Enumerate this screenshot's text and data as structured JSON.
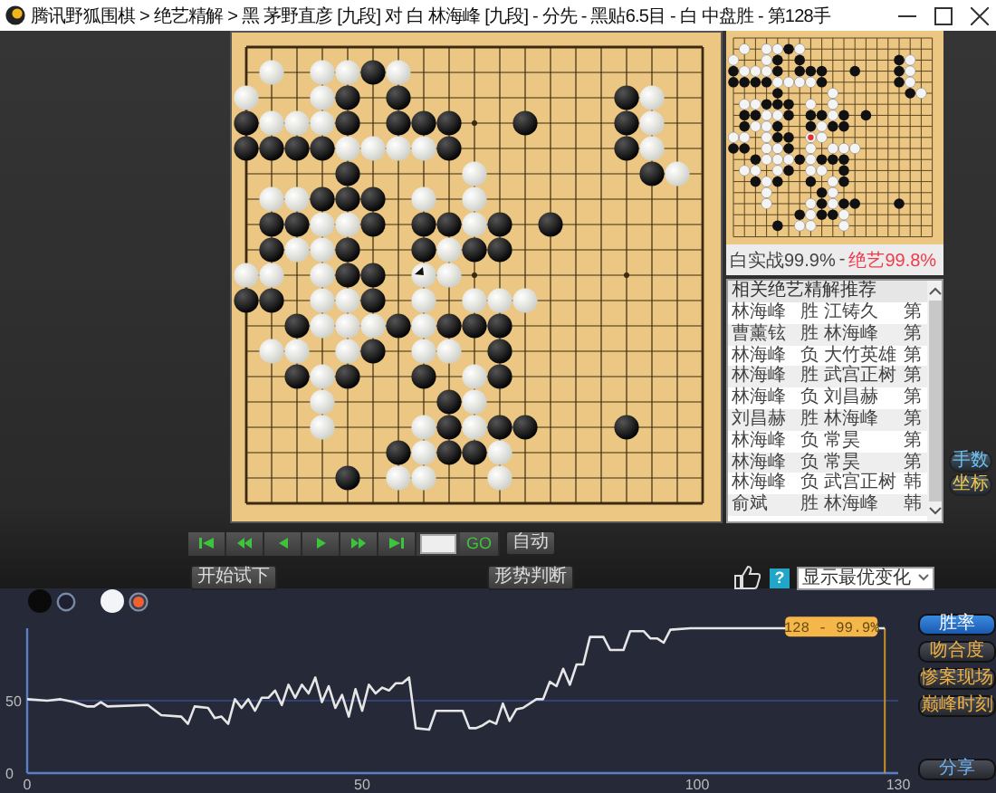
{
  "window": {
    "title": "腾讯野狐围棋 > 绝艺精解 > 黑 茅野直彦 [九段] 对 白 林海峰 [九段] - 分先 - 黑贴6.5目 - 白 中盘胜 - 第128手"
  },
  "board": {
    "rows": [
      {
        "cells": [
          {
            "kind": "none"
          },
          {
            "kind": "none"
          },
          {
            "kind": "none"
          },
          {
            "kind": "none"
          },
          {
            "kind": "none"
          },
          {
            "kind": "none"
          },
          {
            "kind": "none"
          },
          {
            "kind": "none"
          },
          {
            "kind": "none"
          },
          {
            "kind": "none"
          },
          {
            "kind": "none"
          },
          {
            "kind": "none"
          },
          {
            "kind": "none"
          },
          {
            "kind": "none"
          },
          {
            "kind": "none"
          },
          {
            "kind": "none"
          },
          {
            "kind": "none"
          },
          {
            "kind": "none"
          },
          {
            "kind": "none"
          }
        ]
      },
      {
        "cells": [
          {
            "kind": "none"
          },
          {
            "kind": "white"
          },
          {
            "kind": "none"
          },
          {
            "kind": "white"
          },
          {
            "kind": "white"
          },
          {
            "kind": "black"
          },
          {
            "kind": "white"
          },
          {
            "kind": "none"
          },
          {
            "kind": "none"
          },
          {
            "kind": "none"
          },
          {
            "kind": "none"
          },
          {
            "kind": "none"
          },
          {
            "kind": "none"
          },
          {
            "kind": "none"
          },
          {
            "kind": "none"
          },
          {
            "kind": "none"
          },
          {
            "kind": "none"
          },
          {
            "kind": "none"
          },
          {
            "kind": "none"
          }
        ]
      },
      {
        "cells": [
          {
            "kind": "white"
          },
          {
            "kind": "none"
          },
          {
            "kind": "none"
          },
          {
            "kind": "white"
          },
          {
            "kind": "black"
          },
          {
            "kind": "none"
          },
          {
            "kind": "black"
          },
          {
            "kind": "none"
          },
          {
            "kind": "none"
          },
          {
            "kind": "none"
          },
          {
            "kind": "none"
          },
          {
            "kind": "none"
          },
          {
            "kind": "none"
          },
          {
            "kind": "none"
          },
          {
            "kind": "none"
          },
          {
            "kind": "black"
          },
          {
            "kind": "white"
          },
          {
            "kind": "none"
          },
          {
            "kind": "none"
          }
        ]
      },
      {
        "cells": [
          {
            "kind": "black"
          },
          {
            "kind": "white"
          },
          {
            "kind": "white"
          },
          {
            "kind": "white"
          },
          {
            "kind": "black"
          },
          {
            "kind": "none"
          },
          {
            "kind": "black"
          },
          {
            "kind": "black"
          },
          {
            "kind": "black"
          },
          {
            "kind": "none"
          },
          {
            "kind": "none"
          },
          {
            "kind": "black"
          },
          {
            "kind": "none"
          },
          {
            "kind": "none"
          },
          {
            "kind": "none"
          },
          {
            "kind": "black"
          },
          {
            "kind": "white"
          },
          {
            "kind": "none"
          },
          {
            "kind": "none"
          }
        ]
      },
      {
        "cells": [
          {
            "kind": "black"
          },
          {
            "kind": "black"
          },
          {
            "kind": "black"
          },
          {
            "kind": "black"
          },
          {
            "kind": "white"
          },
          {
            "kind": "white"
          },
          {
            "kind": "white"
          },
          {
            "kind": "white"
          },
          {
            "kind": "black"
          },
          {
            "kind": "none"
          },
          {
            "kind": "none"
          },
          {
            "kind": "none"
          },
          {
            "kind": "none"
          },
          {
            "kind": "none"
          },
          {
            "kind": "none"
          },
          {
            "kind": "black"
          },
          {
            "kind": "white"
          },
          {
            "kind": "none"
          },
          {
            "kind": "none"
          }
        ]
      },
      {
        "cells": [
          {
            "kind": "none"
          },
          {
            "kind": "none"
          },
          {
            "kind": "none"
          },
          {
            "kind": "none"
          },
          {
            "kind": "black"
          },
          {
            "kind": "none"
          },
          {
            "kind": "none"
          },
          {
            "kind": "none"
          },
          {
            "kind": "none"
          },
          {
            "kind": "white"
          },
          {
            "kind": "none"
          },
          {
            "kind": "none"
          },
          {
            "kind": "none"
          },
          {
            "kind": "none"
          },
          {
            "kind": "none"
          },
          {
            "kind": "none"
          },
          {
            "kind": "black"
          },
          {
            "kind": "white"
          },
          {
            "kind": "none"
          }
        ]
      },
      {
        "cells": [
          {
            "kind": "none"
          },
          {
            "kind": "white"
          },
          {
            "kind": "white"
          },
          {
            "kind": "black"
          },
          {
            "kind": "black"
          },
          {
            "kind": "black"
          },
          {
            "kind": "none"
          },
          {
            "kind": "white"
          },
          {
            "kind": "none"
          },
          {
            "kind": "white"
          },
          {
            "kind": "none"
          },
          {
            "kind": "none"
          },
          {
            "kind": "none"
          },
          {
            "kind": "none"
          },
          {
            "kind": "none"
          },
          {
            "kind": "none"
          },
          {
            "kind": "none"
          },
          {
            "kind": "none"
          },
          {
            "kind": "none"
          }
        ]
      },
      {
        "cells": [
          {
            "kind": "none"
          },
          {
            "kind": "black"
          },
          {
            "kind": "black"
          },
          {
            "kind": "white"
          },
          {
            "kind": "white"
          },
          {
            "kind": "black"
          },
          {
            "kind": "none"
          },
          {
            "kind": "black"
          },
          {
            "kind": "black"
          },
          {
            "kind": "white"
          },
          {
            "kind": "black"
          },
          {
            "kind": "none"
          },
          {
            "kind": "black"
          },
          {
            "kind": "none"
          },
          {
            "kind": "none"
          },
          {
            "kind": "none"
          },
          {
            "kind": "none"
          },
          {
            "kind": "none"
          },
          {
            "kind": "none"
          }
        ]
      },
      {
        "cells": [
          {
            "kind": "none"
          },
          {
            "kind": "black"
          },
          {
            "kind": "white"
          },
          {
            "kind": "white"
          },
          {
            "kind": "black"
          },
          {
            "kind": "none"
          },
          {
            "kind": "none"
          },
          {
            "kind": "black"
          },
          {
            "kind": "white"
          },
          {
            "kind": "black"
          },
          {
            "kind": "black"
          },
          {
            "kind": "none"
          },
          {
            "kind": "none"
          },
          {
            "kind": "none"
          },
          {
            "kind": "none"
          },
          {
            "kind": "none"
          },
          {
            "kind": "none"
          },
          {
            "kind": "none"
          },
          {
            "kind": "none"
          }
        ]
      },
      {
        "cells": [
          {
            "kind": "white"
          },
          {
            "kind": "white"
          },
          {
            "kind": "none"
          },
          {
            "kind": "white"
          },
          {
            "kind": "black"
          },
          {
            "kind": "black"
          },
          {
            "kind": "none"
          },
          {
            "kind": "marked"
          },
          {
            "kind": "white"
          },
          {
            "kind": "none"
          },
          {
            "kind": "none"
          },
          {
            "kind": "none"
          },
          {
            "kind": "none"
          },
          {
            "kind": "none"
          },
          {
            "kind": "none"
          },
          {
            "kind": "none"
          },
          {
            "kind": "none"
          },
          {
            "kind": "none"
          },
          {
            "kind": "none"
          }
        ]
      },
      {
        "cells": [
          {
            "kind": "black"
          },
          {
            "kind": "black"
          },
          {
            "kind": "none"
          },
          {
            "kind": "white"
          },
          {
            "kind": "white"
          },
          {
            "kind": "black"
          },
          {
            "kind": "none"
          },
          {
            "kind": "white"
          },
          {
            "kind": "none"
          },
          {
            "kind": "white"
          },
          {
            "kind": "white"
          },
          {
            "kind": "white"
          },
          {
            "kind": "none"
          },
          {
            "kind": "none"
          },
          {
            "kind": "none"
          },
          {
            "kind": "none"
          },
          {
            "kind": "none"
          },
          {
            "kind": "none"
          },
          {
            "kind": "none"
          }
        ]
      },
      {
        "cells": [
          {
            "kind": "none"
          },
          {
            "kind": "none"
          },
          {
            "kind": "black"
          },
          {
            "kind": "white"
          },
          {
            "kind": "white"
          },
          {
            "kind": "white"
          },
          {
            "kind": "black"
          },
          {
            "kind": "white"
          },
          {
            "kind": "black"
          },
          {
            "kind": "black"
          },
          {
            "kind": "black"
          },
          {
            "kind": "none"
          },
          {
            "kind": "none"
          },
          {
            "kind": "none"
          },
          {
            "kind": "none"
          },
          {
            "kind": "none"
          },
          {
            "kind": "none"
          },
          {
            "kind": "none"
          },
          {
            "kind": "none"
          }
        ]
      },
      {
        "cells": [
          {
            "kind": "none"
          },
          {
            "kind": "white"
          },
          {
            "kind": "white"
          },
          {
            "kind": "none"
          },
          {
            "kind": "white"
          },
          {
            "kind": "black"
          },
          {
            "kind": "none"
          },
          {
            "kind": "white"
          },
          {
            "kind": "white"
          },
          {
            "kind": "none"
          },
          {
            "kind": "black"
          },
          {
            "kind": "none"
          },
          {
            "kind": "none"
          },
          {
            "kind": "none"
          },
          {
            "kind": "none"
          },
          {
            "kind": "none"
          },
          {
            "kind": "none"
          },
          {
            "kind": "none"
          },
          {
            "kind": "none"
          }
        ]
      },
      {
        "cells": [
          {
            "kind": "none"
          },
          {
            "kind": "none"
          },
          {
            "kind": "black"
          },
          {
            "kind": "white"
          },
          {
            "kind": "black"
          },
          {
            "kind": "none"
          },
          {
            "kind": "none"
          },
          {
            "kind": "black"
          },
          {
            "kind": "none"
          },
          {
            "kind": "white"
          },
          {
            "kind": "black"
          },
          {
            "kind": "none"
          },
          {
            "kind": "none"
          },
          {
            "kind": "none"
          },
          {
            "kind": "none"
          },
          {
            "kind": "none"
          },
          {
            "kind": "none"
          },
          {
            "kind": "none"
          },
          {
            "kind": "none"
          }
        ]
      },
      {
        "cells": [
          {
            "kind": "none"
          },
          {
            "kind": "none"
          },
          {
            "kind": "none"
          },
          {
            "kind": "white"
          },
          {
            "kind": "none"
          },
          {
            "kind": "none"
          },
          {
            "kind": "none"
          },
          {
            "kind": "none"
          },
          {
            "kind": "black"
          },
          {
            "kind": "white"
          },
          {
            "kind": "none"
          },
          {
            "kind": "none"
          },
          {
            "kind": "none"
          },
          {
            "kind": "none"
          },
          {
            "kind": "none"
          },
          {
            "kind": "none"
          },
          {
            "kind": "none"
          },
          {
            "kind": "none"
          },
          {
            "kind": "none"
          }
        ]
      },
      {
        "cells": [
          {
            "kind": "none"
          },
          {
            "kind": "none"
          },
          {
            "kind": "none"
          },
          {
            "kind": "white"
          },
          {
            "kind": "none"
          },
          {
            "kind": "none"
          },
          {
            "kind": "none"
          },
          {
            "kind": "white"
          },
          {
            "kind": "black"
          },
          {
            "kind": "white"
          },
          {
            "kind": "black"
          },
          {
            "kind": "black"
          },
          {
            "kind": "none"
          },
          {
            "kind": "none"
          },
          {
            "kind": "none"
          },
          {
            "kind": "black"
          },
          {
            "kind": "none"
          },
          {
            "kind": "none"
          },
          {
            "kind": "none"
          }
        ]
      },
      {
        "cells": [
          {
            "kind": "none"
          },
          {
            "kind": "none"
          },
          {
            "kind": "none"
          },
          {
            "kind": "none"
          },
          {
            "kind": "none"
          },
          {
            "kind": "none"
          },
          {
            "kind": "black"
          },
          {
            "kind": "white"
          },
          {
            "kind": "black"
          },
          {
            "kind": "black"
          },
          {
            "kind": "white"
          },
          {
            "kind": "none"
          },
          {
            "kind": "none"
          },
          {
            "kind": "none"
          },
          {
            "kind": "none"
          },
          {
            "kind": "none"
          },
          {
            "kind": "none"
          },
          {
            "kind": "none"
          },
          {
            "kind": "none"
          }
        ]
      },
      {
        "cells": [
          {
            "kind": "none"
          },
          {
            "kind": "none"
          },
          {
            "kind": "none"
          },
          {
            "kind": "none"
          },
          {
            "kind": "black"
          },
          {
            "kind": "none"
          },
          {
            "kind": "white"
          },
          {
            "kind": "white"
          },
          {
            "kind": "none"
          },
          {
            "kind": "none"
          },
          {
            "kind": "white"
          },
          {
            "kind": "none"
          },
          {
            "kind": "none"
          },
          {
            "kind": "none"
          },
          {
            "kind": "none"
          },
          {
            "kind": "none"
          },
          {
            "kind": "none"
          },
          {
            "kind": "none"
          },
          {
            "kind": "none"
          }
        ]
      },
      {
        "cells": [
          {
            "kind": "none"
          },
          {
            "kind": "none"
          },
          {
            "kind": "none"
          },
          {
            "kind": "none"
          },
          {
            "kind": "none"
          },
          {
            "kind": "none"
          },
          {
            "kind": "none"
          },
          {
            "kind": "none"
          },
          {
            "kind": "none"
          },
          {
            "kind": "none"
          },
          {
            "kind": "none"
          },
          {
            "kind": "none"
          },
          {
            "kind": "none"
          },
          {
            "kind": "none"
          },
          {
            "kind": "none"
          },
          {
            "kind": "none"
          },
          {
            "kind": "none"
          },
          {
            "kind": "none"
          },
          {
            "kind": "none"
          }
        ]
      }
    ]
  },
  "score": {
    "actual": "白实战99.9%",
    "separator": "-",
    "ai": "绝艺99.8%"
  },
  "games_list": {
    "header": "相关绝艺精解推荐",
    "rows": [
      {
        "black": "林海峰",
        "result": "胜",
        "white": "江铸久",
        "more": "第"
      },
      {
        "black": "曹薰铉",
        "result": "胜",
        "white": "林海峰",
        "more": "第"
      },
      {
        "black": "林海峰",
        "result": "负",
        "white": "大竹英雄",
        "more": "第"
      },
      {
        "black": "林海峰",
        "result": "胜",
        "white": "武宫正树",
        "more": "第"
      },
      {
        "black": "林海峰",
        "result": "负",
        "white": "刘昌赫",
        "more": "第"
      },
      {
        "black": "刘昌赫",
        "result": "胜",
        "white": "林海峰",
        "more": "第"
      },
      {
        "black": "林海峰",
        "result": "负",
        "white": "常昊",
        "more": "第"
      },
      {
        "black": "林海峰",
        "result": "负",
        "white": "常昊",
        "more": "第"
      },
      {
        "black": "林海峰",
        "result": "负",
        "white": "武宫正树",
        "more": "韩"
      },
      {
        "black": "俞斌",
        "result": "胜",
        "white": "林海峰",
        "more": "韩"
      }
    ]
  },
  "side_buttons": [
    "手数",
    "坐标"
  ],
  "playback": {
    "go": "GO",
    "auto": "自动"
  },
  "actions": {
    "try": "开始试下",
    "judge": "形势判断",
    "help": "?",
    "dropdown": "显示最优变化"
  },
  "chart_tabs": [
    {
      "label": "胜率",
      "selected": true
    },
    {
      "label": "吻合度",
      "selected": false
    },
    {
      "label": "惨案现场",
      "selected": false
    },
    {
      "label": "巅峰时刻",
      "selected": false
    }
  ],
  "share": "分享",
  "chart_data": {
    "type": "line",
    "xlim": [
      0,
      130
    ],
    "ylim": [
      0,
      100
    ],
    "xticks": [
      0,
      50,
      100,
      130
    ],
    "yticks": [
      0,
      50
    ],
    "x": [
      0,
      3,
      5,
      7,
      9,
      10,
      11,
      12,
      18,
      20,
      23,
      24,
      25,
      27,
      28,
      29,
      30,
      31,
      32,
      33,
      34,
      35,
      36,
      37,
      38,
      39,
      40,
      41,
      42,
      43,
      44,
      45,
      46,
      47,
      48,
      49,
      50,
      51,
      52,
      53,
      54,
      55,
      56,
      57,
      58,
      60,
      61,
      65,
      66,
      67,
      68,
      69,
      70,
      71,
      72,
      73,
      74,
      76,
      77,
      78,
      79,
      80,
      81,
      82,
      83,
      84,
      86,
      87,
      89,
      90,
      92,
      93,
      94,
      95,
      96,
      99,
      128
    ],
    "series": [
      {
        "color": "#e6e6e6",
        "values": [
          51,
          50,
          51,
          49,
          46,
          46,
          49,
          46,
          47,
          40,
          39,
          34,
          46,
          45,
          38,
          39,
          34,
          51,
          45,
          51,
          43,
          52,
          52,
          57,
          47,
          61,
          52,
          61,
          55,
          66,
          49,
          60,
          45,
          54,
          39,
          58,
          43,
          61,
          55,
          59,
          57,
          62,
          62,
          66,
          31,
          30,
          43,
          43,
          31,
          31,
          33,
          36,
          34,
          48,
          36,
          44,
          45,
          51,
          51,
          63,
          60,
          72,
          61,
          75,
          75,
          94,
          94,
          85,
          85,
          98,
          98,
          93,
          93,
          90,
          99,
          100,
          100
        ]
      }
    ],
    "ref_lines": [
      {
        "axis": "y",
        "value": 50,
        "color": "#3a4a8a"
      },
      {
        "axis": "x",
        "value": 128,
        "color": "#c8902a"
      }
    ],
    "annotations": [
      {
        "x": 128,
        "y": 99.9,
        "text": "128 - 99.9%"
      }
    ]
  }
}
